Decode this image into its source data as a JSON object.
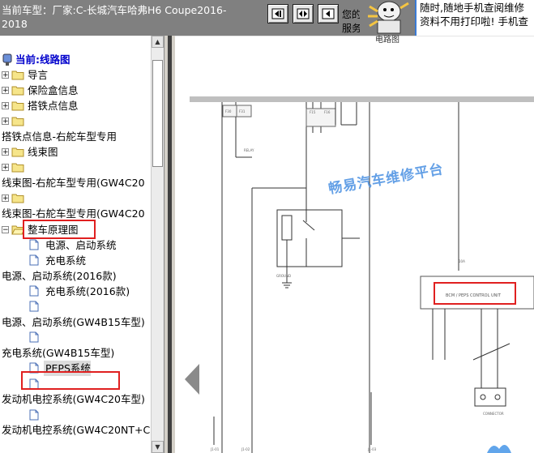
{
  "topbar": {
    "car_model_line1": "当前车型：厂家:C-长城汽车哈弗H6 Coupe2016-",
    "car_model_line2": "2018",
    "nav_buttons": [
      "first-page-icon",
      "fit-page-icon",
      "prev-page-icon"
    ],
    "service_line1": "您的",
    "service_line2": "服务",
    "ad_line1": "随时,随地手机查阅维修",
    "ad_line2": "资料不用打印啦! 手机查"
  },
  "tree": {
    "root_label": "当前:线路图",
    "items": [
      {
        "label": "导言",
        "type": "folder"
      },
      {
        "label": "保险盒信息",
        "type": "folder"
      },
      {
        "label": "搭铁点信息",
        "type": "folder"
      },
      {
        "label": "",
        "type": "folder"
      },
      {
        "label": "搭铁点信息-右舵车型专用",
        "type": "text"
      },
      {
        "label": "线束图",
        "type": "folder"
      },
      {
        "label": "",
        "type": "folder"
      },
      {
        "label": "线束图-右舵车型专用(GW4C20",
        "type": "text"
      },
      {
        "label": "",
        "type": "folder"
      },
      {
        "label": "线束图-右舵车型专用(GW4C20",
        "type": "text"
      },
      {
        "label": "整车原理图",
        "type": "folder-open"
      },
      {
        "label": "电源、启动系统",
        "type": "doc"
      },
      {
        "label": "充电系统",
        "type": "doc"
      },
      {
        "label": "电源、启动系统(2016款)",
        "type": "text"
      },
      {
        "label": "充电系统(2016款)",
        "type": "doc"
      },
      {
        "label": "",
        "type": "doc"
      },
      {
        "label": "电源、启动系统(GW4B15车型)",
        "type": "text"
      },
      {
        "label": "",
        "type": "doc"
      },
      {
        "label": "充电系统(GW4B15车型)",
        "type": "text"
      },
      {
        "label": "PEPS系统",
        "type": "doc"
      },
      {
        "label": "",
        "type": "doc"
      },
      {
        "label": "发动机电控系统(GW4C20车型)",
        "type": "text"
      },
      {
        "label": "",
        "type": "doc"
      },
      {
        "label": "发动机电控系统(GW4C20NT+C",
        "type": "text"
      }
    ]
  },
  "diagram": {
    "watermark": "畅易汽车维修平台",
    "partial_title": "电路图"
  }
}
